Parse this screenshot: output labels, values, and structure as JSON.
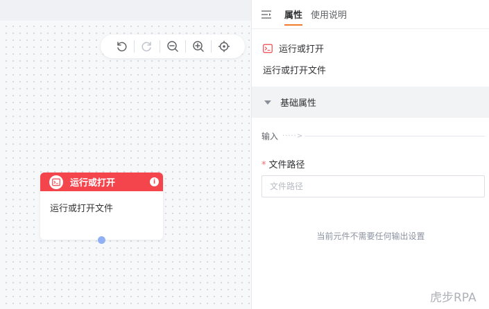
{
  "toolbar": {
    "buttons": [
      {
        "icon": "undo-icon"
      },
      {
        "icon": "redo-icon"
      },
      {
        "icon": "zoom-out-icon"
      },
      {
        "icon": "zoom-in-icon"
      },
      {
        "icon": "locate-icon"
      }
    ]
  },
  "node": {
    "title": "运行或打开",
    "body": "运行或打开文件",
    "info": "i",
    "color": "#f4444c"
  },
  "panel": {
    "tabs": [
      "属性",
      "使用说明"
    ],
    "component_title": "运行或打开",
    "component_desc": "运行或打开文件",
    "section_title": "基础属性",
    "input_label": "输入",
    "input_dots": "·····>",
    "field_label": "文件路径",
    "field_required": "*",
    "field_placeholder": "文件路径",
    "field_value": "",
    "output_note": "当前元件不需要任何输出设置",
    "watermark": "虎步RPA"
  },
  "colors": {
    "accent": "#f07b2a",
    "node_header": "#f4444c",
    "port": "#8fb0f4"
  }
}
